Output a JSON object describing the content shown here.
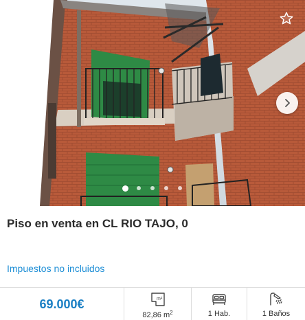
{
  "listing": {
    "title": "Piso en venta en CL RIO TAJO, 0",
    "tax_note": "Impuestos no incluidos",
    "price": "69.000€",
    "area": {
      "value": "82,86 m",
      "unit_exponent": "2",
      "icon": "floor-area-icon",
      "icon_text": "m²"
    },
    "bedrooms": {
      "label": "1 Hab.",
      "icon": "bed-icon"
    },
    "bathrooms": {
      "label": "1 Baños",
      "icon": "shower-icon"
    }
  },
  "carousel": {
    "photo_count": 5,
    "active_index": 0,
    "prev_icon": "chevron-left-icon",
    "next_icon": "chevron-right-icon",
    "favorite_icon": "star-outline-icon"
  },
  "colors": {
    "price": "#1a7fc4",
    "link": "#1f8fd6",
    "title": "#2b2b2b",
    "divider": "#dcdcdc"
  }
}
